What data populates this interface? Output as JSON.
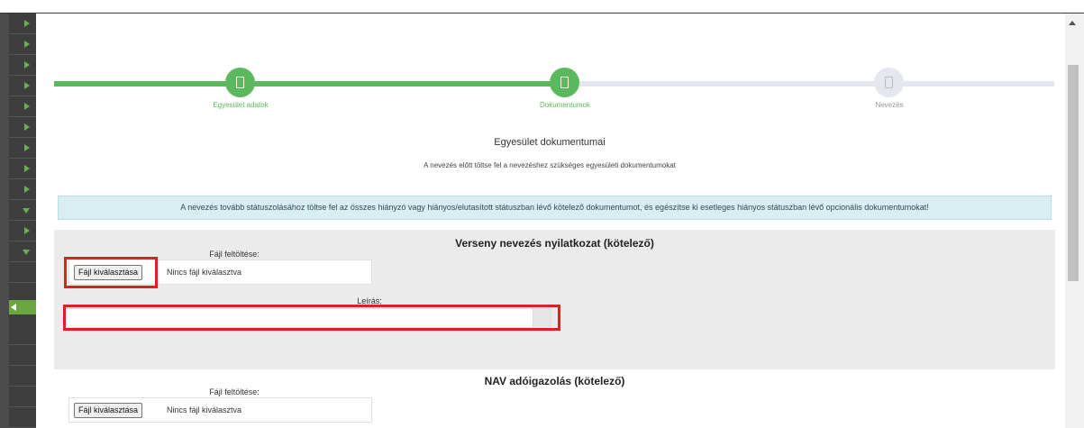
{
  "stepper": {
    "steps": [
      {
        "label": "Egyesület adatok",
        "state": "done"
      },
      {
        "label": "Dokumentumok",
        "state": "active"
      },
      {
        "label": "Nevezés",
        "state": "pending"
      }
    ],
    "colors": {
      "done": "#5cb85c",
      "pending": "#e4e8ee",
      "label_done": "#5cb85c",
      "label_pending": "#999999"
    }
  },
  "page": {
    "title": "Egyesület dokumentumai",
    "subtitle": "A nevezés előtt töltse fel a nevezéshez szükséges egyesületi dokumentumokat"
  },
  "alert": {
    "text": "A nevezés tovább státuszolásához töltse fel az összes hiányzó vagy hiányos/elutasított státuszban lévő kötelező dokumentumot, és egészítse ki esetleges hiányos státuszban lévő opcionális dokumentumokat!"
  },
  "documents": [
    {
      "title": "Verseny nevezés nyilatkozat (kötelező)",
      "upload_label": "Fájl feltöltése:",
      "button_label": "Fájl kiválasztása",
      "file_status": "Nincs fájl kiválasztva",
      "description_label": "Leírás:",
      "description_value": ""
    },
    {
      "title": "NAV adóigazolás (kötelező)",
      "upload_label": "Fájl feltöltése:",
      "button_label": "Fájl kiválasztása",
      "file_status": "Nincs fájl kiválasztva"
    }
  ]
}
